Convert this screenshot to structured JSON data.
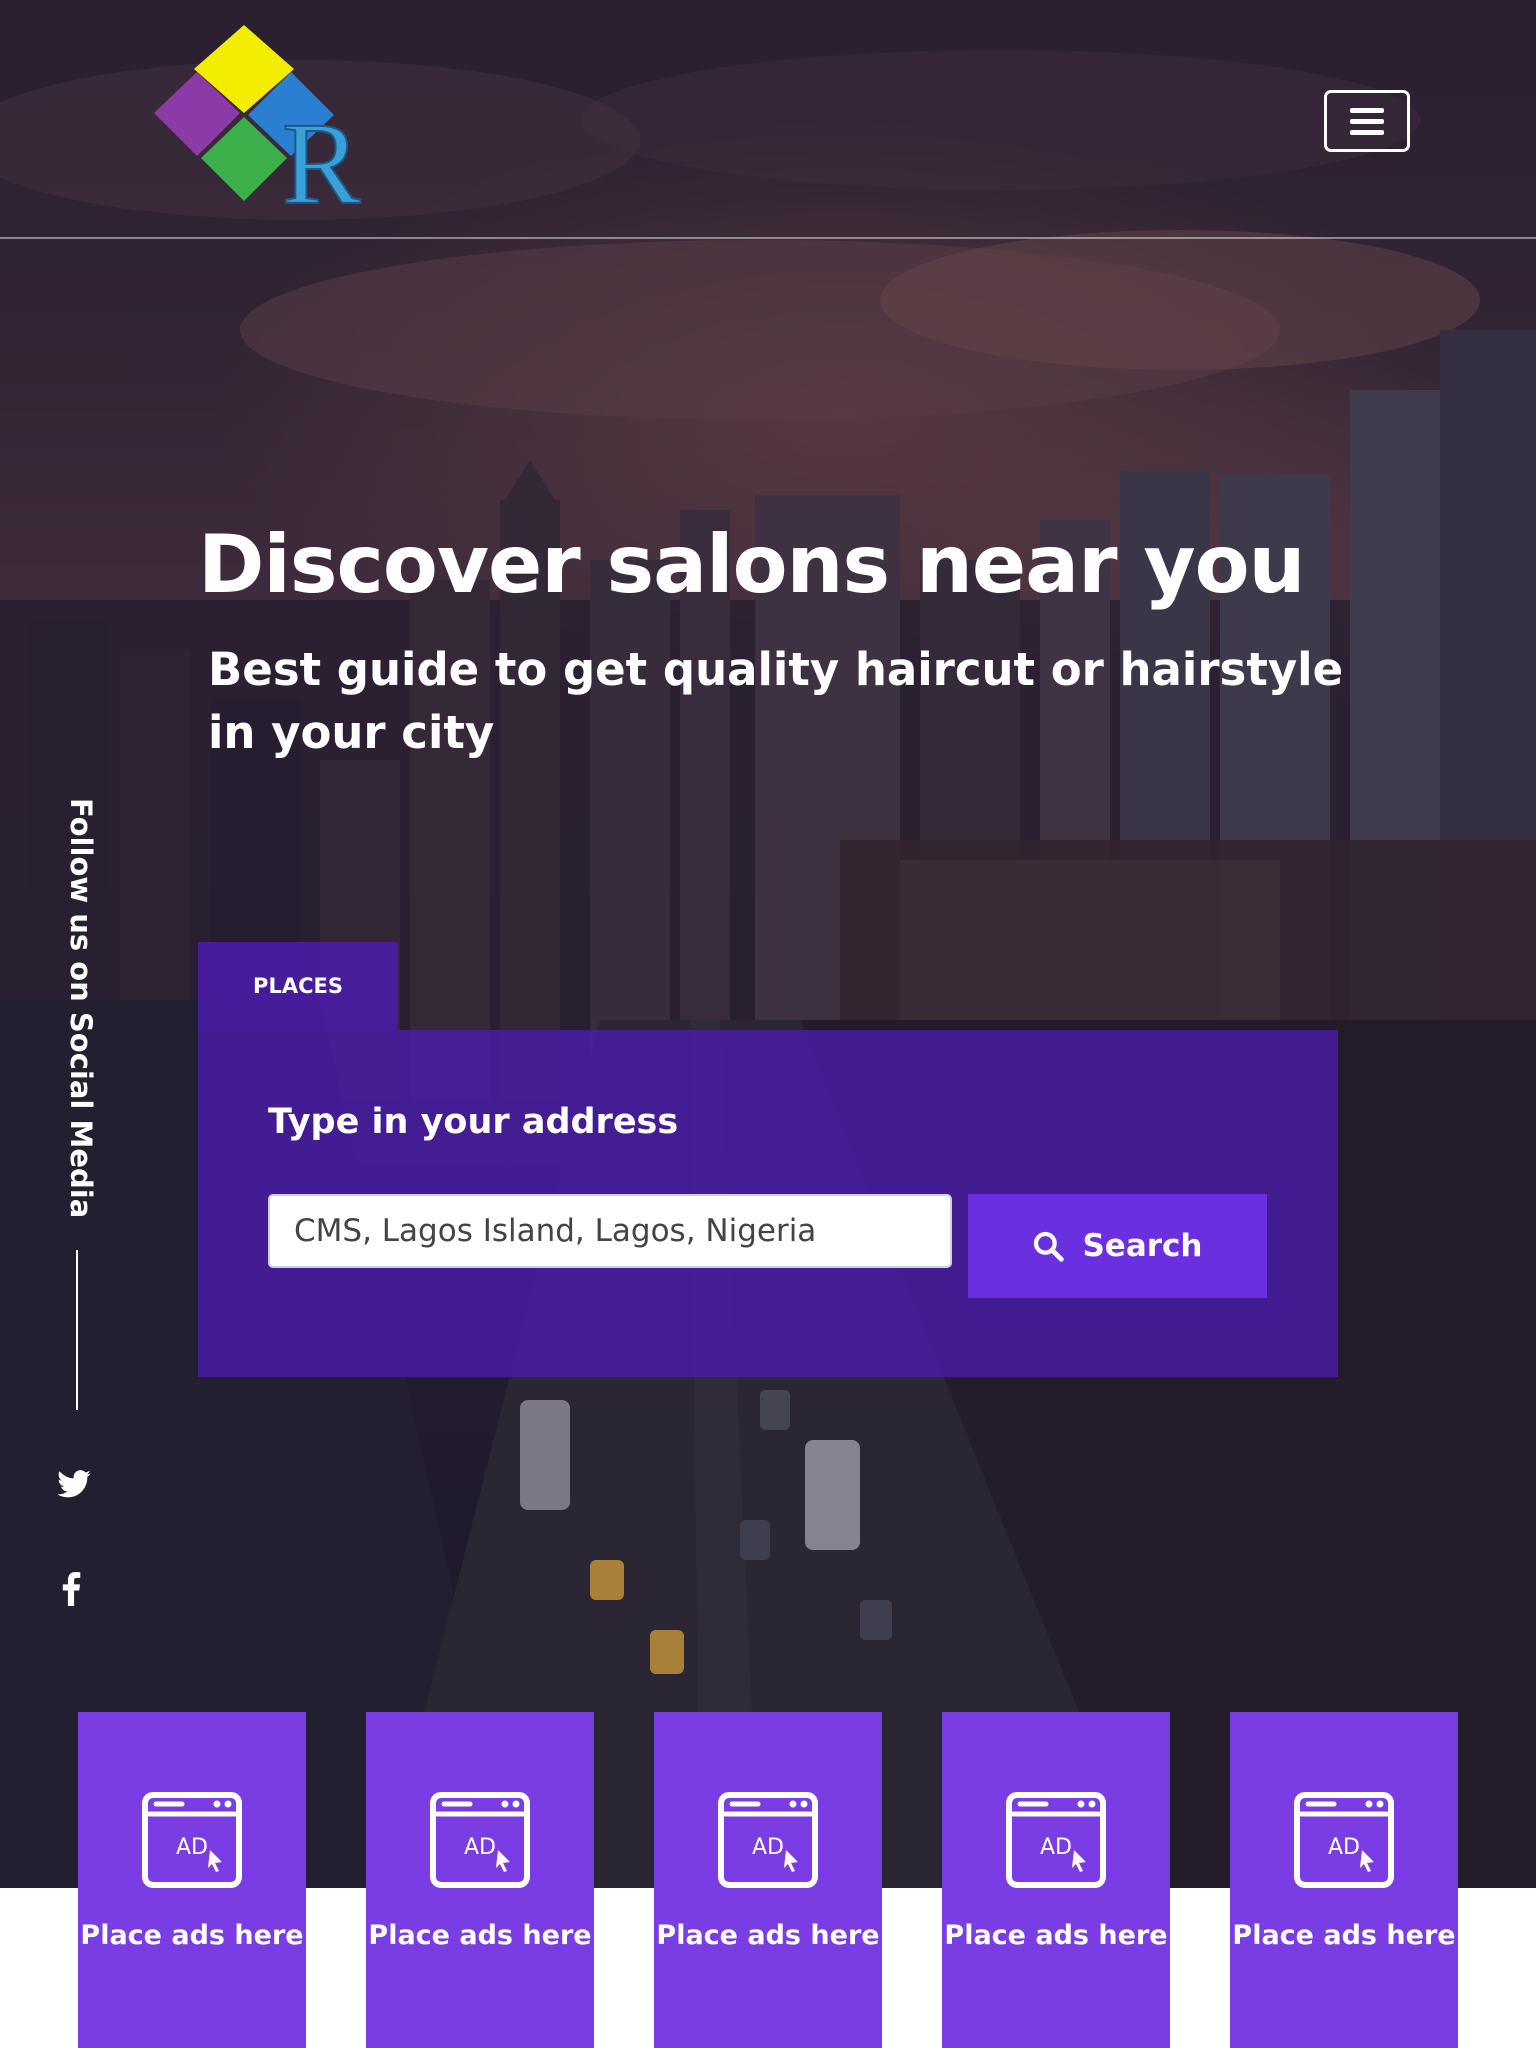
{
  "header": {
    "logo_alt": "R",
    "menu_button_label": "menu"
  },
  "hero": {
    "title": "Discover salons near you",
    "subtitle": "Best guide to get quality haircut or hairstyle in your city"
  },
  "social": {
    "label": "Follow us on Social Media",
    "icons": [
      "twitter-icon",
      "facebook-icon"
    ]
  },
  "search": {
    "tab_label": "PLACES",
    "field_label": "Type in your address",
    "address_value": "CMS, Lagos Island, Lagos, Nigeria",
    "button_label": "Search"
  },
  "ads": [
    {
      "label": "Place ads here",
      "icon_text": "AD"
    },
    {
      "label": "Place ads here",
      "icon_text": "AD"
    },
    {
      "label": "Place ads here",
      "icon_text": "AD"
    },
    {
      "label": "Place ads here",
      "icon_text": "AD"
    },
    {
      "label": "Place ads here",
      "icon_text": "AD"
    }
  ],
  "colors": {
    "accent": "#7a3de4",
    "panel": "#4a1caa",
    "button": "#6a30e0"
  }
}
